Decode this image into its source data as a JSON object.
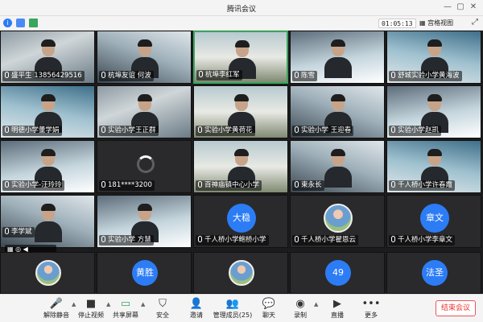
{
  "window": {
    "title": "腾讯会议",
    "minimize_glyph": "—",
    "restore_glyph": "▢",
    "close_glyph": "✕"
  },
  "status": {
    "info_glyph": "i",
    "timer": "01:05:13",
    "view_label": "宫格视图",
    "expand_glyph": "⤢"
  },
  "grid": {
    "row1": [
      {
        "name": "盛平生 13856429516",
        "type": "video"
      },
      {
        "name": "杭埠友谊  何波",
        "type": "video"
      },
      {
        "name": "杭埠李红军",
        "type": "video"
      },
      {
        "name": "陈雪",
        "type": "video"
      },
      {
        "name": "舒城实验小学黄海波",
        "type": "video"
      }
    ],
    "row2": [
      {
        "name": "明德小学董学娟",
        "type": "video"
      },
      {
        "name": "实验小学王正群",
        "type": "video"
      },
      {
        "name": "实验小学黄荷花",
        "type": "video"
      },
      {
        "name": "实验小学 王迎春",
        "type": "video"
      },
      {
        "name": "实验小学赵凯",
        "type": "video"
      }
    ],
    "row3": [
      {
        "name": "实验小学-汪玲玲",
        "type": "video"
      },
      {
        "name": "181****3200",
        "type": "loading"
      },
      {
        "name": "百神庙镇中心小学",
        "type": "video"
      },
      {
        "name": "束永长",
        "type": "video"
      },
      {
        "name": "千人桥小学许春霞",
        "type": "video"
      }
    ],
    "row4": [
      {
        "name": "李学斌",
        "type": "video"
      },
      {
        "name": "实验小学 方慧",
        "type": "video"
      },
      {
        "name": "千人桥小学鲍桥小学",
        "type": "avatar",
        "badge": "大稳"
      },
      {
        "name": "千人桥小学翟恩云",
        "type": "photo"
      },
      {
        "name": "千人桥小学李章文",
        "type": "avatar",
        "badge": "章文"
      }
    ],
    "row5": [
      {
        "type": "photo"
      },
      {
        "type": "avatar",
        "badge": "黄胜"
      },
      {
        "type": "photo"
      },
      {
        "type": "avatar",
        "badge": "49"
      },
      {
        "type": "avatar",
        "badge": "法圣"
      }
    ]
  },
  "toolbar": {
    "items": [
      {
        "label": "解除静音",
        "glyph": "🎤"
      },
      {
        "label": "停止视频",
        "glyph": "■"
      },
      {
        "label": "共享屏幕",
        "glyph": "▭"
      },
      {
        "label": "安全",
        "glyph": "⛉"
      },
      {
        "label": "邀请",
        "glyph": "👤"
      },
      {
        "label": "管理成员(25)",
        "glyph": "👥"
      },
      {
        "label": "聊天",
        "glyph": "💬"
      },
      {
        "label": "录制",
        "glyph": "◉"
      },
      {
        "label": "直播",
        "glyph": "▶"
      },
      {
        "label": "更多",
        "glyph": "•••"
      }
    ],
    "end_label": "结束会议",
    "caret_glyph": "▲"
  },
  "colors": {
    "accent": "#2c7cf6",
    "active_speaker": "#3aa55c",
    "end_button": "#e33333"
  }
}
